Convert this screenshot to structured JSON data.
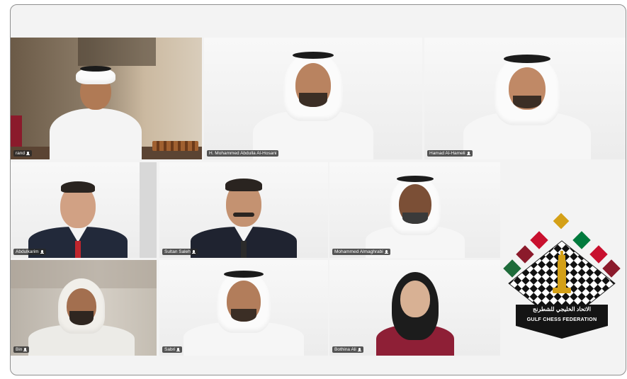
{
  "participants": [
    {
      "id": "p1",
      "name": "rand"
    },
    {
      "id": "p2",
      "name": "H. Mohammed Abdulla Al-Hosani"
    },
    {
      "id": "p3",
      "name": "Hamad Al-Hameli"
    },
    {
      "id": "p4",
      "name": "Abdulkarim"
    },
    {
      "id": "p5",
      "name": "Sultan Saleh"
    },
    {
      "id": "p6",
      "name": "Mohammed Almaghrabi"
    },
    {
      "id": "p7",
      "name": "Bin"
    },
    {
      "id": "p8",
      "name": "Sabri"
    },
    {
      "id": "p9",
      "name": "Bothina Ali"
    }
  ],
  "logo": {
    "arabic_name": "الاتحاد الخليجي للشطرنج",
    "english_name": "GULF CHESS FEDERATION",
    "flag_colors": [
      "#1e6b3a",
      "#8b1a2b",
      "#c8102e",
      "#007a3d",
      "#ffffff"
    ],
    "accent": "#d4a017"
  },
  "colors": {
    "active_border": "#6c6fc9",
    "window_border": "#8f8f8f"
  }
}
